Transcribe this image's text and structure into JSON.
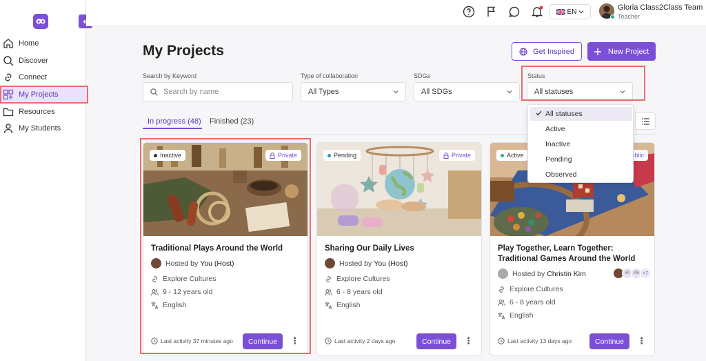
{
  "sidebar": {
    "items": [
      {
        "label": "Home",
        "icon": "home-icon"
      },
      {
        "label": "Discover",
        "icon": "search-icon"
      },
      {
        "label": "Connect",
        "icon": "link-icon"
      },
      {
        "label": "My Projects",
        "icon": "projects-icon"
      },
      {
        "label": "Resources",
        "icon": "folder-icon"
      },
      {
        "label": "My Students",
        "icon": "students-icon"
      }
    ],
    "collapse_label": "«"
  },
  "topbar": {
    "language": "EN",
    "user_name": "Gloria Class2Class Team",
    "user_role": "Teacher"
  },
  "page": {
    "title": "My Projects",
    "get_inspired": "Get Inspired",
    "new_project": "New Project"
  },
  "filters": {
    "keyword_label": "Search by Keyword",
    "keyword_placeholder": "Search by name",
    "collab_label": "Type of collaboration",
    "collab_value": "All Types",
    "sdg_label": "SDGs",
    "sdg_value": "All SDGs",
    "status_label": "Status",
    "status_value": "All statuses"
  },
  "status_dropdown": {
    "options": [
      "All statuses",
      "Active",
      "Inactive",
      "Pending",
      "Observed"
    ],
    "selected": "All statuses"
  },
  "tabs": [
    {
      "label": "In progress (48)"
    },
    {
      "label": "Finished (23)"
    }
  ],
  "cards": [
    {
      "status": "Inactive",
      "status_color": "#333333",
      "visibility": "Private",
      "title": "Traditional Plays Around the World",
      "hosted_prefix": "Hosted by",
      "host": "You (Host)",
      "theme": "Explore Cultures",
      "age": "9 - 12 years old",
      "language": "English",
      "last_activity": "Last activity 37 minutes ago",
      "continue": "Continue"
    },
    {
      "status": "Pending",
      "status_color": "#2f8fd8",
      "visibility": "Private",
      "title": "Sharing Our Daily Lives",
      "hosted_prefix": "Hosted by",
      "host": "You (Host)",
      "theme": "Explore Cultures",
      "age": "6 - 8 years old",
      "language": "English",
      "last_activity": "Last activity 2 days ago",
      "continue": "Continue"
    },
    {
      "status": "Active",
      "status_color": "#2fb07a",
      "visibility": "Public",
      "title": "Play Together, Learn Together: Traditional Games Around the World",
      "hosted_prefix": "Hosted by",
      "host": "Christin Kim",
      "participants": [
        "KI",
        "AS"
      ],
      "extra_participants": "+7",
      "theme": "Explore Cultures",
      "age": "6 - 8 years old",
      "language": "English",
      "last_activity": "Last activity 13 days ago",
      "continue": "Continue"
    }
  ],
  "colors": {
    "accent": "#7b4fd6",
    "highlight_box": "#ef6a6a"
  }
}
